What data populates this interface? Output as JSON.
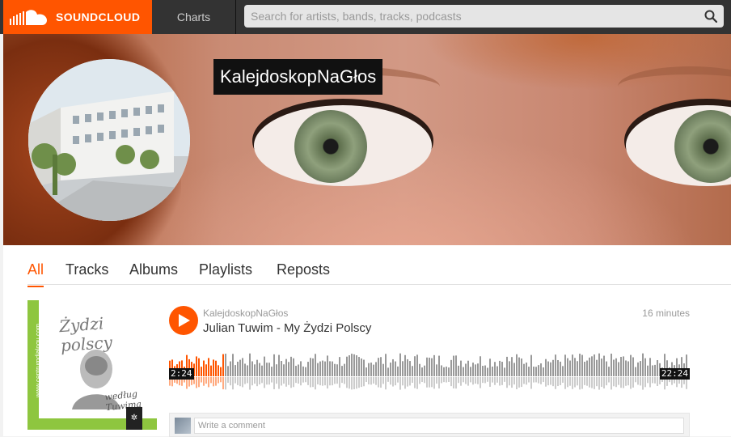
{
  "header": {
    "logo_text": "SOUNDCLOUD",
    "nav_charts": "Charts",
    "search_placeholder": "Search for artists, bands, tracks, podcasts"
  },
  "profile": {
    "username": "KalejdoskopNaGłos"
  },
  "tabs": [
    {
      "label": "All",
      "active": true
    },
    {
      "label": "Tracks",
      "active": false
    },
    {
      "label": "Albums",
      "active": false
    },
    {
      "label": "Playlists",
      "active": false
    },
    {
      "label": "Reposts",
      "active": false
    }
  ],
  "track": {
    "uploader": "KalejdoskopNaGłos",
    "title": "Julian Tuwim - My Żydzi Polscy",
    "posted": "16 minutes",
    "elapsed": "2:24",
    "duration": "22:24",
    "progress": 0.107,
    "artwork": {
      "title": "Żydzi polscy",
      "subtitle": "według Tuwima",
      "side_text": "www.centrumdialogu.com"
    }
  },
  "comment": {
    "placeholder": "Write a comment"
  },
  "colors": {
    "accent": "#ff5500",
    "header_bg": "#333333",
    "wave_played": "#ff5500",
    "wave_unplayed": "#999999"
  },
  "icons": [
    "soundcloud-logo-icon",
    "search-icon",
    "play-icon",
    "artwork-badge-icon"
  ]
}
